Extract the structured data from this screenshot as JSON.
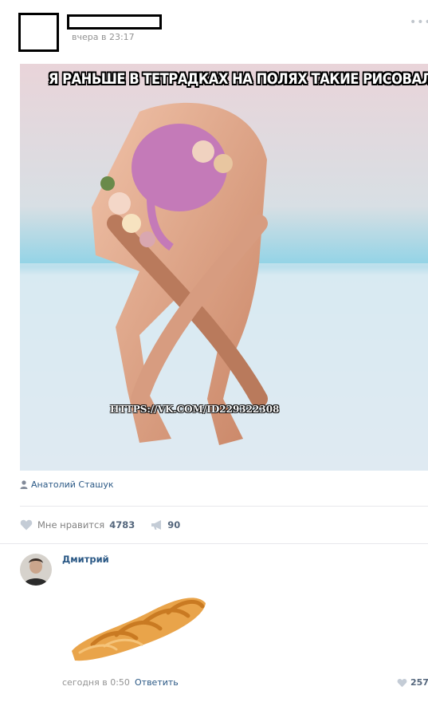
{
  "post": {
    "time": "вчера в 23:17",
    "caption": "Я РАНЬШЕ В ТЕТРАДКАХ НА ПОЛЯХ ТАКИЕ РИСОВАЛ",
    "watermark": "HTTPS://VK.COM/ID229322308",
    "author_signature": "Анатолий Сташук",
    "like_label": "Мне нравится",
    "like_count": "4783",
    "share_count": "90",
    "more_icon": "ellipsis-icon"
  },
  "comment": {
    "author": "Дмитрий",
    "time": "сегодня в 0:50",
    "reply_label": "Ответить",
    "like_count": "257"
  },
  "colors": {
    "link": "#2a5885",
    "muted": "#939393",
    "count": "#55677d",
    "divider": "#e7e8ec"
  }
}
